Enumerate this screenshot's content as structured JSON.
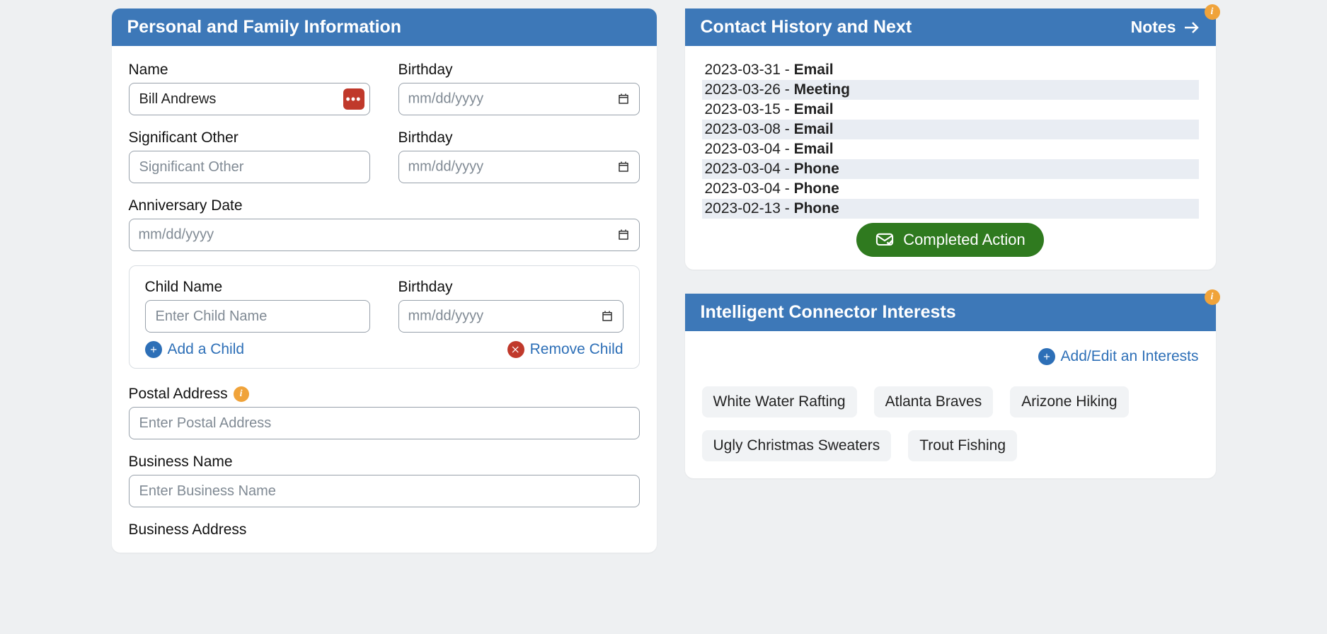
{
  "personal": {
    "header": "Personal and Family Information",
    "name_label": "Name",
    "name_value": "Bill Andrews",
    "birthday_label": "Birthday",
    "date_placeholder": "mm/dd/yyyy",
    "so_label": "Significant Other",
    "so_placeholder": "Significant Other",
    "anniv_label": "Anniversary Date",
    "child_name_label": "Child Name",
    "child_name_placeholder": "Enter Child Name",
    "child_birthday_label": "Birthday",
    "add_child_label": "Add a Child",
    "remove_child_label": "Remove Child",
    "postal_label": "Postal Address",
    "postal_placeholder": "Enter Postal Address",
    "biz_name_label": "Business Name",
    "biz_name_placeholder": "Enter Business Name",
    "biz_addr_label": "Business Address"
  },
  "history": {
    "header": "Contact History and Next",
    "notes_label": "Notes",
    "completed_label": "Completed Action",
    "items": [
      {
        "date": "2023-03-31",
        "type": "Email"
      },
      {
        "date": "2023-03-26",
        "type": "Meeting"
      },
      {
        "date": "2023-03-15",
        "type": "Email"
      },
      {
        "date": "2023-03-08",
        "type": "Email"
      },
      {
        "date": "2023-03-04",
        "type": "Email"
      },
      {
        "date": "2023-03-04",
        "type": "Phone"
      },
      {
        "date": "2023-03-04",
        "type": "Phone"
      },
      {
        "date": "2023-02-13",
        "type": "Phone"
      }
    ]
  },
  "interests": {
    "header": "Intelligent Connector Interests",
    "add_label": "Add/Edit an Interests",
    "tags": [
      "White Water Rafting",
      "Atlanta Braves",
      "Arizone Hiking",
      "Ugly Christmas Sweaters",
      "Trout Fishing"
    ]
  },
  "icons": {
    "info_char": "i",
    "dots": "•••"
  }
}
